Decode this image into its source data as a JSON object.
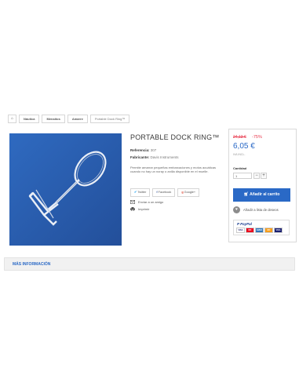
{
  "breadcrumb": {
    "home_icon": "home-icon",
    "items": [
      "Náutica",
      "Menaitos",
      "Amarre",
      "Portable Dock Ring™"
    ]
  },
  "product": {
    "title": "PORTABLE DOCK RING™",
    "reference_label": "Referencia:",
    "reference_value": "307",
    "manufacturer_label": "Fabricante:",
    "manufacturer_value": "Davis Instruments",
    "description": "Permite amarrar pequeñas embarcaciones y motos acuáticas cuando no hay un noray o anilla disponible en el muelle."
  },
  "social": {
    "twitter": "Twitter",
    "facebook": "Facebook",
    "google": "Google+"
  },
  "links": {
    "send_friend": "Enviar a un amigo",
    "print": "Imprimir"
  },
  "buy": {
    "old_price": "24,13 €",
    "discount": "-75%",
    "price": "6,05 €",
    "tax_note": "IVA INCL.",
    "quantity_label": "Cantidad",
    "quantity_value": "1",
    "minus": "−",
    "plus": "+",
    "add_to_cart": "Añadir al carrito",
    "wishlist": "Añadir a lista de deseos"
  },
  "payments": {
    "paypal": "PayPal",
    "cards": [
      "VISA",
      "MC",
      "AMEX",
      "MC",
      "VISA"
    ]
  },
  "more_info": "MÁS INFORMACIÓN",
  "colors": {
    "accent": "#2a69c6",
    "discount": "#e8364b",
    "photo_bg": "#2c62b4"
  }
}
